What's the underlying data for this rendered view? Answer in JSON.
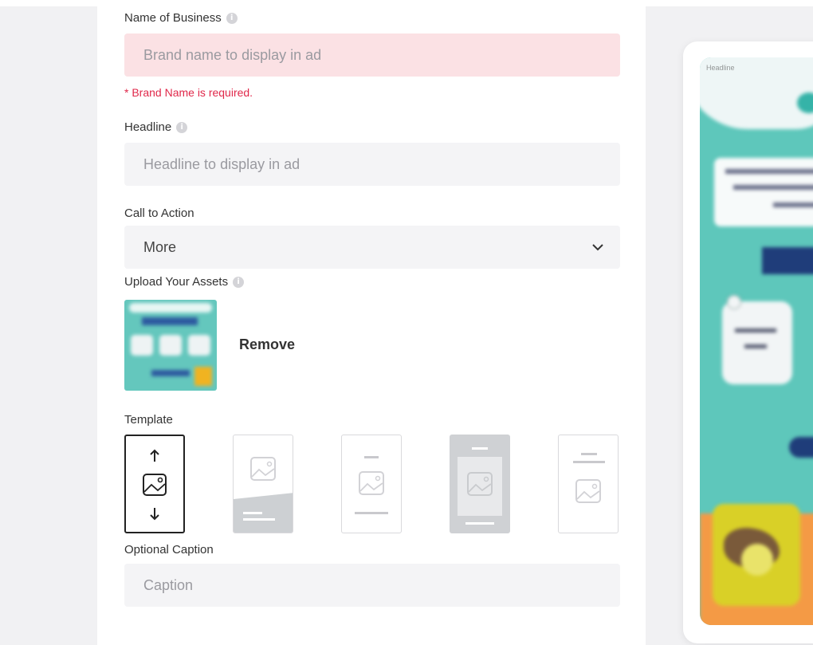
{
  "form": {
    "business_label": "Name of Business",
    "business_placeholder": "Brand name to display in ad",
    "business_error": "* Brand Name is required.",
    "headline_label": "Headline",
    "headline_placeholder": "Headline to display in ad",
    "cta_label": "Call to Action",
    "cta_value": "More",
    "assets_label": "Upload Your Assets",
    "remove_label": "Remove",
    "template_label": "Template",
    "caption_label": "Optional Caption",
    "caption_placeholder": "Caption"
  },
  "preview": {
    "headline_tag": "Headline"
  },
  "icons": {
    "info": "info-icon",
    "chevron": "chevron-down-icon",
    "image": "image-icon"
  },
  "colors": {
    "error_bg": "#fbe1e4",
    "error_text": "#e0284a",
    "teal": "#5ec7bb",
    "navy": "#1f3d7a"
  }
}
